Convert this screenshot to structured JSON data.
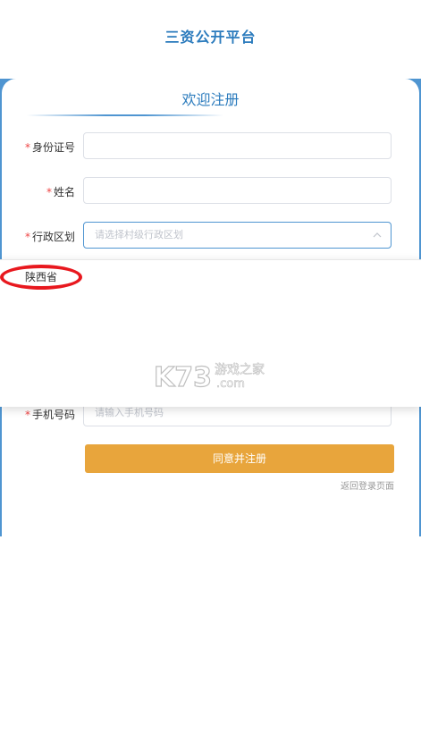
{
  "header": {
    "title": "三资公开平台"
  },
  "card": {
    "welcome": "欢迎注册"
  },
  "form": {
    "id_label": "身份证号",
    "name_label": "姓名",
    "region_label": "行政区划",
    "region_placeholder": "请选择村级行政区划",
    "phone_label": "手机号码",
    "phone_placeholder": "请输入手机号码",
    "required_mark": "*"
  },
  "dropdown": {
    "options": [
      "陕西省"
    ]
  },
  "watermark": {
    "brand": "K73",
    "text1": "游戏之家",
    "text2": ".com"
  },
  "actions": {
    "submit_label": "同意并注册",
    "back_link": "返回登录页面"
  },
  "colors": {
    "accent": "#2b7bbd",
    "band": "#4f95d1",
    "button": "#e8a53c",
    "highlight_circle": "#e8181e"
  }
}
